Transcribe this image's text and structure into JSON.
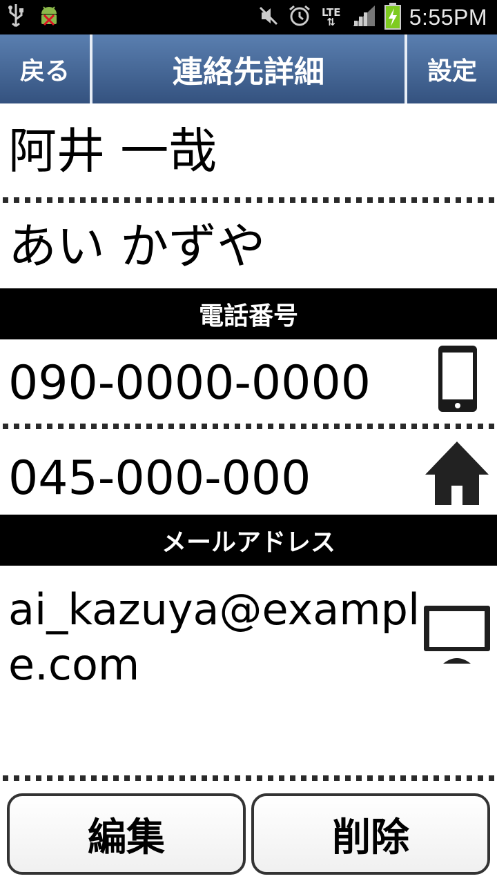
{
  "status_bar": {
    "time": "5:55PM",
    "network": "LTE",
    "icons": [
      "usb-icon",
      "android-debug-icon",
      "mute-icon",
      "alarm-icon",
      "lte-icon",
      "signal-icon",
      "battery-charging-icon"
    ]
  },
  "header": {
    "back_label": "戻る",
    "title": "連絡先詳細",
    "settings_label": "設定"
  },
  "contact": {
    "name": "阿井 一哉",
    "reading": "あい かずや"
  },
  "sections": {
    "phone_header": "電話番号",
    "email_header": "メールアドレス"
  },
  "phones": [
    {
      "number": "090-0000-0000",
      "icon": "mobile-phone-icon"
    },
    {
      "number": "045-000-000",
      "icon": "home-icon"
    }
  ],
  "email": {
    "address": "ai_kazuya@example.com",
    "icon": "computer-monitor-icon"
  },
  "actions": {
    "edit_label": "編集",
    "delete_label": "削除"
  },
  "colors": {
    "header_bar": "#3d5f8e",
    "section_bar": "#000000",
    "battery": "#7ecb20"
  }
}
